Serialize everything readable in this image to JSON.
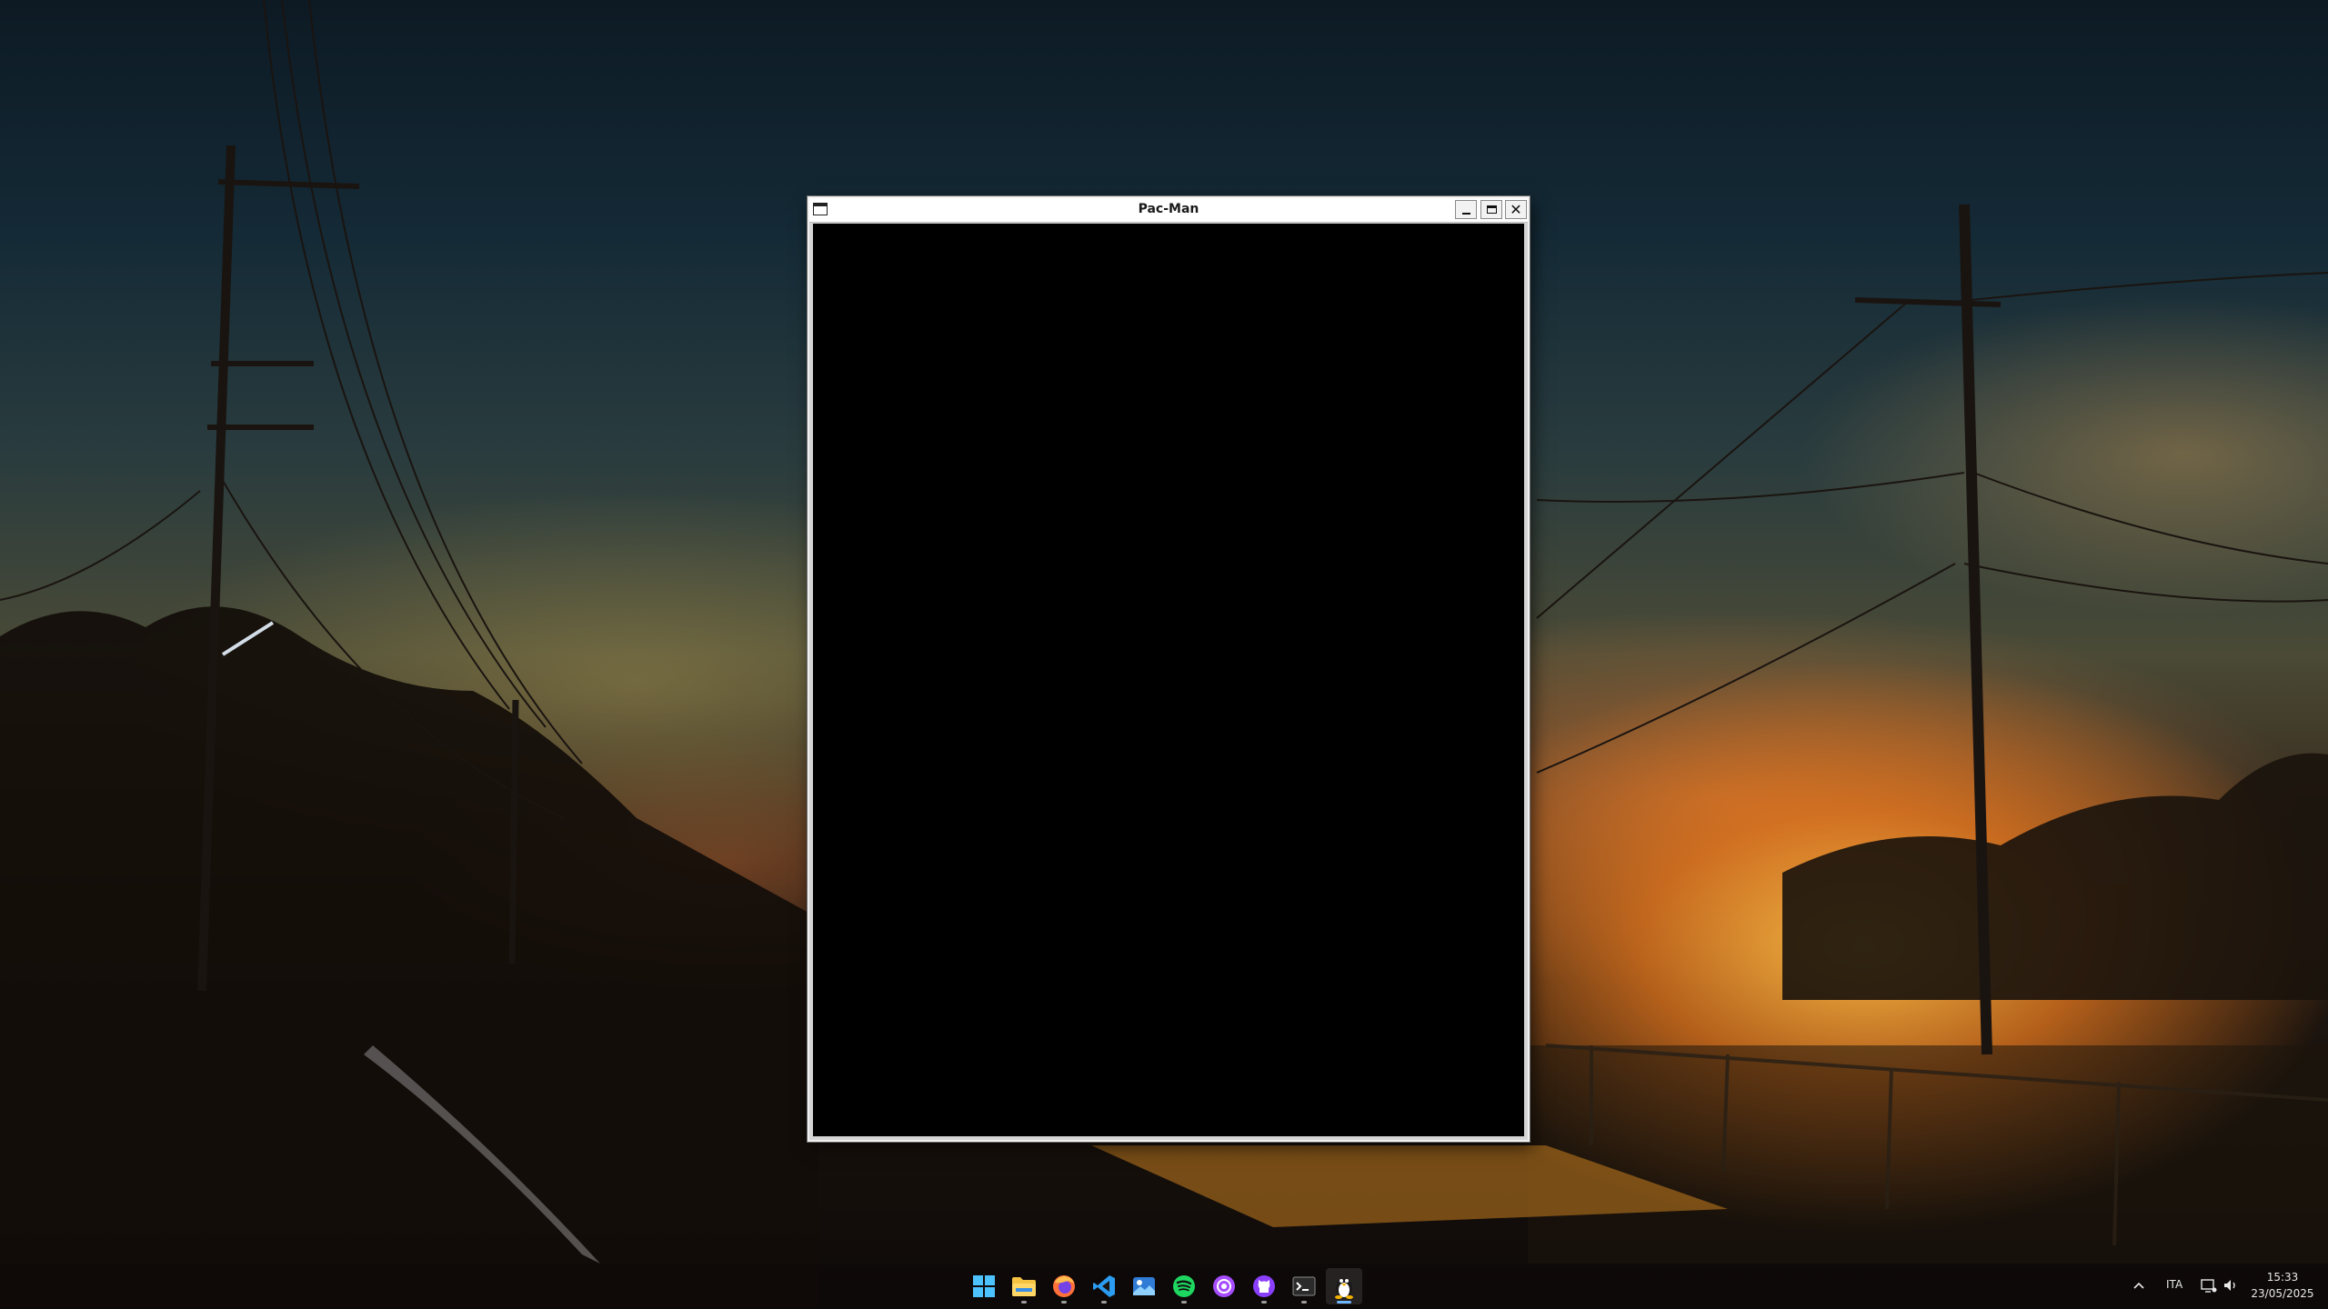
{
  "window": {
    "title": "Pac-Man",
    "icon": "window-app-icon",
    "controls": [
      "minimize-icon",
      "maximize-icon",
      "close-icon"
    ],
    "close_glyph": "✕"
  },
  "taskbar": {
    "apps": [
      {
        "name": "start-button",
        "icon": "windows-logo-icon",
        "running": false
      },
      {
        "name": "file-explorer",
        "icon": "folder-icon",
        "running": true
      },
      {
        "name": "firefox",
        "icon": "firefox-icon",
        "running": true
      },
      {
        "name": "vscode",
        "icon": "vscode-icon",
        "running": true
      },
      {
        "name": "photos",
        "icon": "photos-icon",
        "running": false
      },
      {
        "name": "spotify",
        "icon": "spotify-icon",
        "running": true
      },
      {
        "name": "podcast-app",
        "icon": "podcast-icon",
        "running": false
      },
      {
        "name": "github-desktop",
        "icon": "github-icon",
        "running": true
      },
      {
        "name": "terminal",
        "icon": "terminal-icon",
        "running": true
      },
      {
        "name": "linux-app",
        "icon": "tux-icon",
        "running": true,
        "active": true
      }
    ],
    "tray": {
      "chevron": "chevron-up-icon",
      "language": "ITA",
      "network": "network-icon",
      "volume": "volume-icon",
      "time": "15:33",
      "date": "23/05/2025"
    }
  },
  "colors": {
    "canvas": "#000000",
    "active_indicator": "#6fb5ff",
    "spotify": "#1ed760",
    "vscode": "#2b9cf0",
    "podcast": "#a64dff",
    "github": "#8a3ffc"
  }
}
